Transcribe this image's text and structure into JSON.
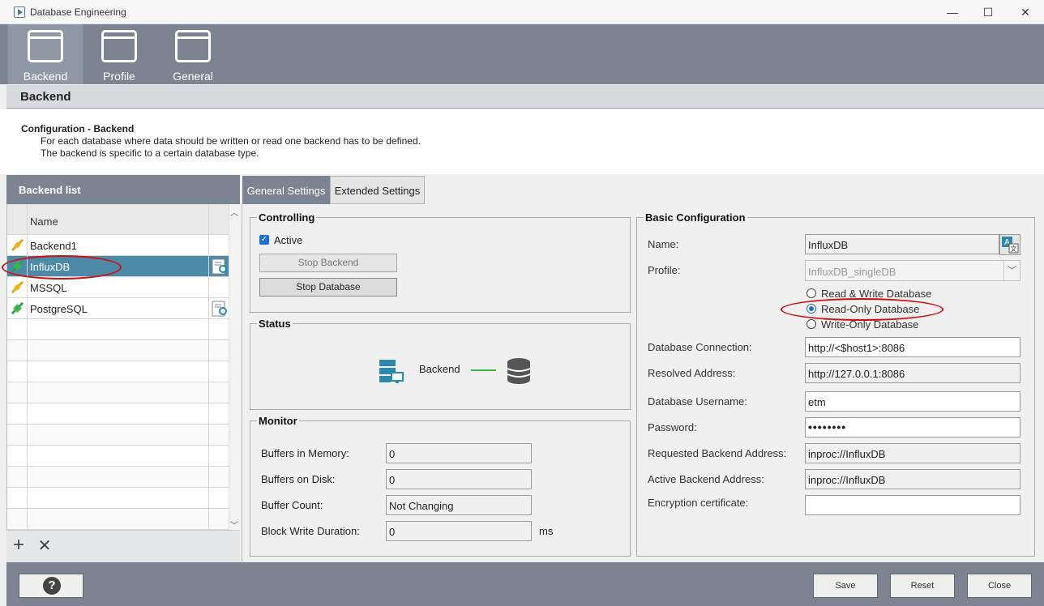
{
  "window": {
    "title": "Database Engineering",
    "controls": {
      "minimize": "—",
      "maximize": "☐",
      "close": "✕"
    }
  },
  "toolbar": {
    "items": [
      {
        "label": "Backend",
        "active": true
      },
      {
        "label": "Profile",
        "active": false
      },
      {
        "label": "General",
        "active": false
      }
    ]
  },
  "section": {
    "title": "Backend"
  },
  "info": {
    "title": "Configuration - Backend",
    "line1": "For each database where data should be written or read one backend has to be defined.",
    "line2": "The backend is specific to a certain database type."
  },
  "backend_list": {
    "header": "Backend list",
    "column_name": "Name",
    "rows": [
      {
        "name": "Backend1",
        "status": "disconnected",
        "certificate": false
      },
      {
        "name": "InfluxDB",
        "status": "connected",
        "certificate": true,
        "selected": true
      },
      {
        "name": "MSSQL",
        "status": "disconnected",
        "certificate": false
      },
      {
        "name": "PostgreSQL",
        "status": "connected",
        "certificate": true
      }
    ],
    "add_label": "+",
    "remove_label": "✕"
  },
  "tabs": [
    {
      "label": "General Settings",
      "active": true
    },
    {
      "label": "Extended Settings",
      "active": false
    }
  ],
  "controlling": {
    "legend": "Controlling",
    "active_label": "Active",
    "active_checked": true,
    "stop_backend": "Stop Backend",
    "stop_database": "Stop Database"
  },
  "status": {
    "legend": "Status",
    "backend_label": "Backend"
  },
  "monitor": {
    "legend": "Monitor",
    "buffers_memory_label": "Buffers in Memory:",
    "buffers_memory": "0",
    "buffers_disk_label": "Buffers on Disk:",
    "buffers_disk": "0",
    "buffer_count_label": "Buffer Count:",
    "buffer_count": "Not Changing",
    "block_write_label": "Block Write Duration:",
    "block_write": "0",
    "block_write_unit": "ms"
  },
  "basic": {
    "legend": "Basic Configuration",
    "name_label": "Name:",
    "name": "InfluxDB",
    "profile_label": "Profile:",
    "profile": "InfluxDB_singleDB",
    "mode_options": [
      "Read & Write Database",
      "Read-Only Database",
      "Write-Only Database"
    ],
    "mode_selected": "Read-Only Database",
    "db_connection_label": "Database Connection:",
    "db_connection": "http://<$host1>:8086",
    "resolved_label": "Resolved Address:",
    "resolved": "http://127.0.0.1:8086",
    "username_label": "Database Username:",
    "username": "etm",
    "password_label": "Password:",
    "password": "••••••••",
    "req_backend_label": "Requested Backend Address:",
    "req_backend": "inproc://InfluxDB",
    "active_backend_label": "Active Backend Address:",
    "active_backend": "inproc://InfluxDB",
    "encryption_label": "Encryption certificate:",
    "encryption": ""
  },
  "footer": {
    "help": "?",
    "save": "Save",
    "reset": "Reset",
    "close": "Close"
  },
  "colors": {
    "accent": "#1b6fcf",
    "toolbar": "#7b8490",
    "selection": "#4c8aa8",
    "highlight": "#d01010",
    "status_ok": "#3bb54a"
  }
}
